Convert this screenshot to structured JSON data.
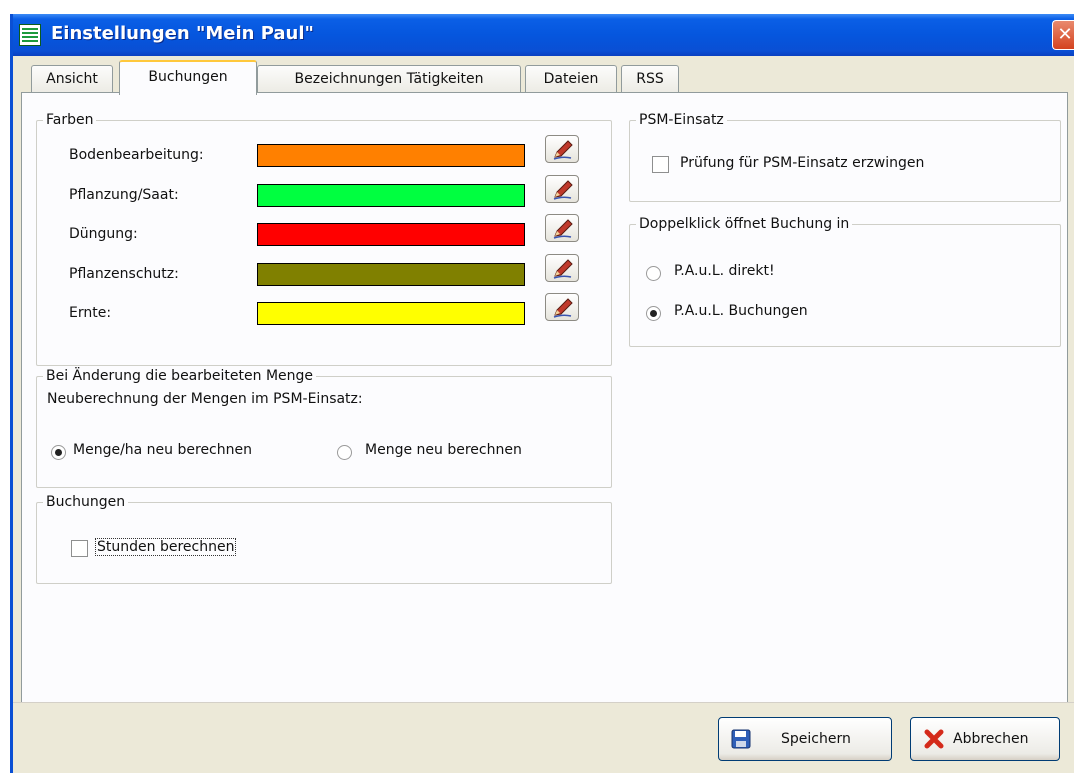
{
  "window": {
    "title": "Einstellungen \"Mein Paul\"",
    "close_glyph": "✕"
  },
  "tabs": [
    {
      "label": "Ansicht"
    },
    {
      "label": "Buchungen",
      "active": true
    },
    {
      "label": "Bezeichnungen Tätigkeiten"
    },
    {
      "label": "Dateien"
    },
    {
      "label": "RSS"
    }
  ],
  "farben": {
    "legend": "Farben",
    "rows": [
      {
        "label": "Bodenbearbeitung:",
        "color": "#ff8000"
      },
      {
        "label": "Pflanzung/Saat:",
        "color": "#00ff40"
      },
      {
        "label": "Düngung:",
        "color": "#ff0000"
      },
      {
        "label": "Pflanzenschutz:",
        "color": "#808000"
      },
      {
        "label": "Ernte:",
        "color": "#ffff00"
      }
    ]
  },
  "menge": {
    "legend": "Bei Änderung die bearbeiteten Menge",
    "description": "Neuberechnung der Mengen im PSM-Einsatz:",
    "options": [
      {
        "label": "Menge/ha neu berechnen",
        "checked": true
      },
      {
        "label": "Menge neu berechnen",
        "checked": false
      }
    ]
  },
  "buchungen": {
    "legend": "Buchungen",
    "checkbox_label": "Stunden berechnen",
    "checked": false
  },
  "psm": {
    "legend": "PSM-Einsatz",
    "checkbox_label": "Prüfung für PSM-Einsatz erzwingen",
    "checked": false
  },
  "doppelklick": {
    "legend": "Doppelklick öffnet Buchung in",
    "options": [
      {
        "label": "P.A.u.L. direkt!",
        "checked": false
      },
      {
        "label": "P.A.u.L. Buchungen",
        "checked": true
      }
    ]
  },
  "buttons": {
    "save": {
      "label": "Speichern",
      "icon": "floppy-disk-icon"
    },
    "cancel": {
      "label": "Abbrechen",
      "icon": "red-x-icon"
    }
  }
}
